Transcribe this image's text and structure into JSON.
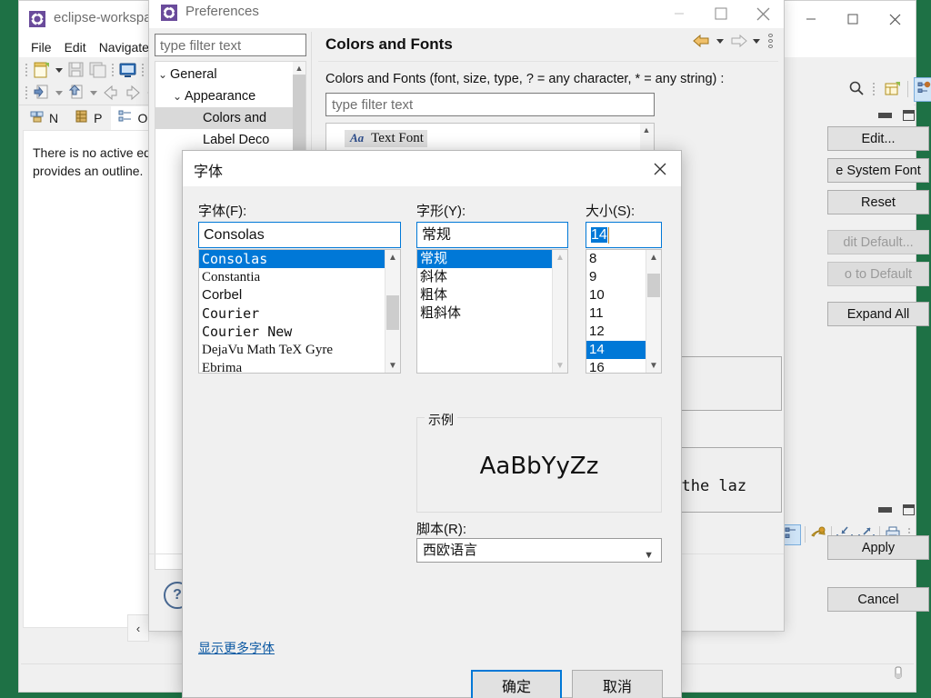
{
  "eclipse": {
    "title": "eclipse-workspa",
    "title_icon": "eclipse-icon",
    "menus": [
      "File",
      "Edit",
      "Navigate"
    ],
    "view_tabs": [
      {
        "label": "N",
        "icon": "package-explorer-icon",
        "active": false
      },
      {
        "label": "P",
        "icon": "project-explorer-icon",
        "active": false
      },
      {
        "label": "O",
        "icon": "outline-icon",
        "active": true
      }
    ],
    "outline_message": "There is no active ed\nprovides an outline.",
    "outline_line1": "There is no active ed",
    "outline_line2": "provides an outline.",
    "collapse_arrow": "‹",
    "window_buttons": {
      "minimize": "—",
      "maximize": "☐",
      "close": "✕"
    }
  },
  "preferences": {
    "title": "Preferences",
    "title_icon": "preferences-gear-icon",
    "window_buttons": {
      "minimize": "—",
      "maximize": "☐",
      "close": "✕"
    },
    "filter_placeholder": "type filter text",
    "filter_value": "",
    "tree": [
      {
        "label": "General",
        "twisty": "⌄",
        "indent": 0,
        "selected": false
      },
      {
        "label": "Appearance",
        "twisty": "⌄",
        "indent": 1,
        "selected": false
      },
      {
        "label": "Colors and",
        "twisty": "",
        "indent": 2,
        "selected": true
      },
      {
        "label": "Label Deco",
        "twisty": "",
        "indent": 2,
        "selected": false
      }
    ],
    "page_title": "Colors and Fonts",
    "page_description": "Colors and Fonts (font, size, type, ? = any character, * = any string) :",
    "page_filter_placeholder": "type filter text",
    "page_tree_items": [
      {
        "badge": "Aa",
        "label": "Text Font",
        "highlighted": true
      }
    ],
    "nav_back_icon": "back-arrow-icon",
    "nav_forward_icon": "forward-arrow-icon",
    "nav_menu_icon": "view-menu-icon",
    "side_buttons": [
      {
        "label": "Edit...",
        "disabled": false
      },
      {
        "label": "e System Font",
        "disabled": false
      },
      {
        "label": "Reset",
        "disabled": false
      },
      {
        "label": "dit Default...",
        "disabled": true
      },
      {
        "label": "o to Default",
        "disabled": true
      },
      {
        "label": "Expand All",
        "disabled": false
      }
    ],
    "apply_label": "Apply",
    "cancel_label": "Cancel",
    "help_icon": "help-question-icon",
    "preview_text": "r the laz"
  },
  "font_dialog": {
    "title": "字体",
    "close_icon": "close-icon",
    "font_label": "字体(F):",
    "font_value": "Consolas",
    "font_list": [
      {
        "name": "Consolas",
        "selected": true
      },
      {
        "name": "Constantia",
        "selected": false
      },
      {
        "name": "Corbel",
        "selected": false
      },
      {
        "name": "Courier",
        "selected": false
      },
      {
        "name": "Courier New",
        "selected": false
      },
      {
        "name": "DejaVu Math TeX Gyre",
        "selected": false
      },
      {
        "name": "Ebrima",
        "selected": false
      }
    ],
    "style_label": "字形(Y):",
    "style_value": "常规",
    "style_list": [
      {
        "name": "常规",
        "selected": true
      },
      {
        "name": "斜体",
        "selected": false
      },
      {
        "name": "粗体",
        "selected": false
      },
      {
        "name": "粗斜体",
        "selected": false
      }
    ],
    "size_label": "大小(S):",
    "size_value": "14",
    "size_list": [
      {
        "name": "8",
        "selected": false
      },
      {
        "name": "9",
        "selected": false
      },
      {
        "name": "10",
        "selected": false
      },
      {
        "name": "11",
        "selected": false
      },
      {
        "name": "12",
        "selected": false
      },
      {
        "name": "14",
        "selected": true
      },
      {
        "name": "16",
        "selected": false
      }
    ],
    "sample_group_label": "示例",
    "sample_text": "AaBbYyZz",
    "script_label": "脚本(R):",
    "script_value": "西欧语言",
    "more_fonts_link": "显示更多字体",
    "ok_label": "确定",
    "cancel_label": "取消"
  },
  "colors": {
    "selection_blue": "#0078d7",
    "desktop_green": "#1e7145",
    "dialog_gray": "#f0f0f0",
    "link_blue": "#0b58a2"
  }
}
